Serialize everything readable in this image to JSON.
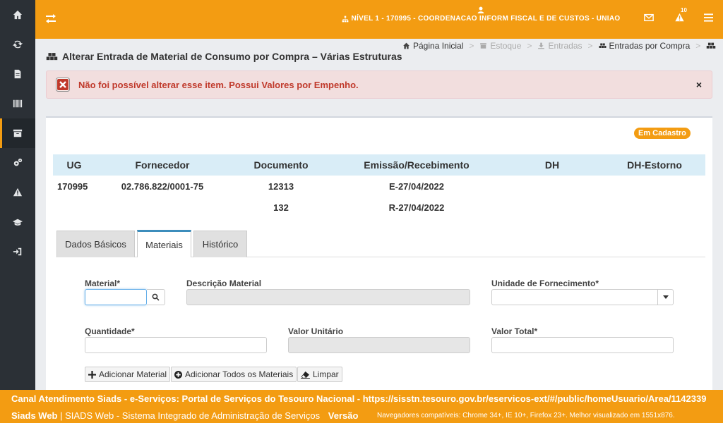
{
  "header": {
    "level_text": "NÍVEL 1 - 170995 - COORDENACAO INFORM FISCAL E DE CUSTOS - UNIAO",
    "alert_count": "10"
  },
  "breadcrumb": {
    "home": "Página Inicial",
    "stock": "Estoque",
    "entries": "Entradas",
    "purchase_entries": "Entradas por Compra"
  },
  "page": {
    "title": "Alterar Entrada de Material de Consumo por Compra – Várias Estruturas"
  },
  "alert": {
    "message": "Não foi possível alterar esse item. Possui Valores por Empenho.",
    "close": "×"
  },
  "status_badge": "Em Cadastro",
  "summary": {
    "headers": [
      "UG",
      "Fornecedor",
      "Documento",
      "Emissão/Recebimento",
      "DH",
      "DH-Estorno"
    ],
    "rows": [
      [
        "170995",
        "02.786.822/0001-75",
        "12313",
        "E-27/04/2022",
        "",
        ""
      ],
      [
        "",
        "",
        "132",
        "R-27/04/2022",
        "",
        ""
      ]
    ]
  },
  "tabs": [
    "Dados Básicos",
    "Materiais",
    "Histórico"
  ],
  "form": {
    "material_label": "Material*",
    "description_label": "Descrição Material",
    "unit_label": "Unidade de Fornecimento*",
    "quantity_label": "Quantidade*",
    "unit_value_label": "Valor Unitário",
    "total_value_label": "Valor Total*",
    "material_value": "",
    "description_value": "",
    "unit_value": "",
    "quantity_value": "",
    "unit_price_value": "",
    "total_value": ""
  },
  "buttons": {
    "add_material": "Adicionar Material",
    "add_all": "Adicionar Todos os Materiais",
    "clear": "Limpar"
  },
  "footer": {
    "line1": "Canal Atendimento Siads - e-Serviços: Portal de Serviços do Tesouro Nacional - https://sisstn.tesouro.gov.br/eservicos-ext/#/public/homeUsuario/Area/1142339",
    "brand": "Siads Web",
    "brand_desc": " | SIADS Web - Sistema Integrado de Administração de Serviços",
    "version_label": "Versão",
    "browsers": "Navegadores compatíveis: Chrome 34+, IE 10+, Firefox 23+. Melhor visualizado em 1551x876."
  },
  "colors": {
    "accent": "#f39c12",
    "sidebar": "#2b3036",
    "alert_bg": "#f2dede",
    "alert_text": "#c0392b",
    "table_header": "#d9edf7",
    "tab_active_border": "#3c8dbc"
  },
  "icons": {
    "sidebar": [
      "home-icon",
      "refresh-icon",
      "document-icon",
      "barcode-icon",
      "archive-icon",
      "gears-icon",
      "warning-icon",
      "graduation-cap-icon",
      "sign-in-icon"
    ]
  }
}
